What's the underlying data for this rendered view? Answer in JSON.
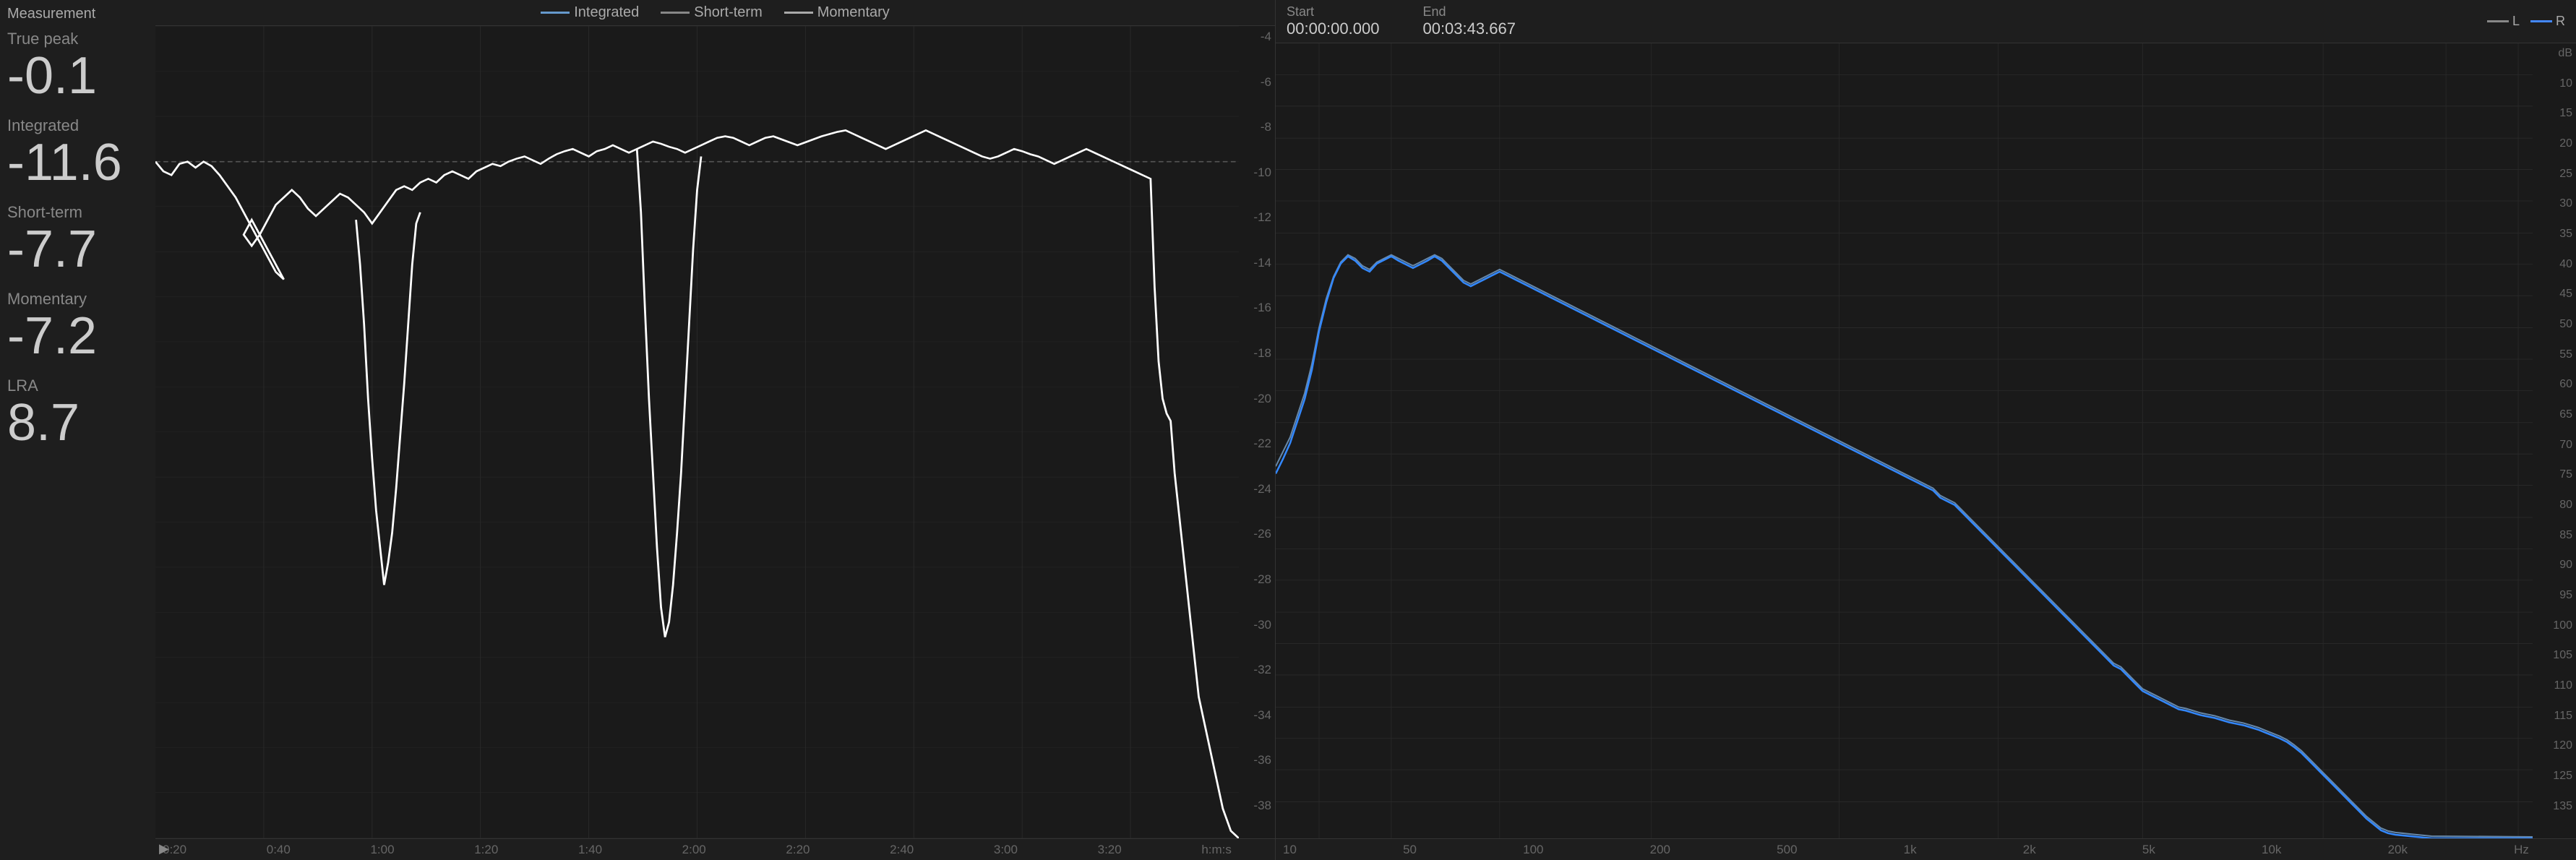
{
  "leftPanel": {
    "title": "Measurement",
    "metrics": [
      {
        "name": "True peak",
        "value": "-0.1"
      },
      {
        "name": "Integrated",
        "value": "-11.6"
      },
      {
        "name": "Short-term",
        "value": "-7.7"
      },
      {
        "name": "Momentary",
        "value": "-7.2"
      },
      {
        "name": "LRA",
        "value": "8.7"
      }
    ]
  },
  "waveformChart": {
    "legend": [
      {
        "label": "Integrated",
        "type": "integrated"
      },
      {
        "label": "Short-term",
        "type": "short-term"
      },
      {
        "label": "Momentary",
        "type": "momentary"
      }
    ],
    "yAxis": [
      "-4",
      "-6",
      "-8",
      "-10",
      "-12",
      "-14",
      "-16",
      "-18",
      "-20",
      "-22",
      "-24",
      "-26",
      "-28",
      "-30",
      "-32",
      "-34",
      "-36",
      "-38"
    ],
    "xAxis": [
      "0:20",
      "0:40",
      "1:00",
      "1:20",
      "1:40",
      "2:00",
      "2:20",
      "2:40",
      "3:00",
      "3:20",
      "h:m:s"
    ]
  },
  "freqChart": {
    "start": {
      "label": "Start",
      "value": "00:00:00.000"
    },
    "end": {
      "label": "End",
      "value": "00:03:43.667"
    },
    "channels": [
      {
        "label": "L",
        "type": "L"
      },
      {
        "label": "R",
        "type": "R"
      }
    ],
    "yAxisLabel": "dB",
    "yAxis": [
      "10",
      "15",
      "20",
      "25",
      "30",
      "35",
      "40",
      "45",
      "50",
      "55",
      "60",
      "65",
      "70",
      "75",
      "80",
      "85",
      "90",
      "95",
      "100",
      "105",
      "110",
      "115",
      "120",
      "125",
      "135"
    ],
    "xAxis": [
      "10",
      "50",
      "100",
      "200",
      "500",
      "1k",
      "2k",
      "5k",
      "10k",
      "20k",
      "Hz"
    ]
  }
}
